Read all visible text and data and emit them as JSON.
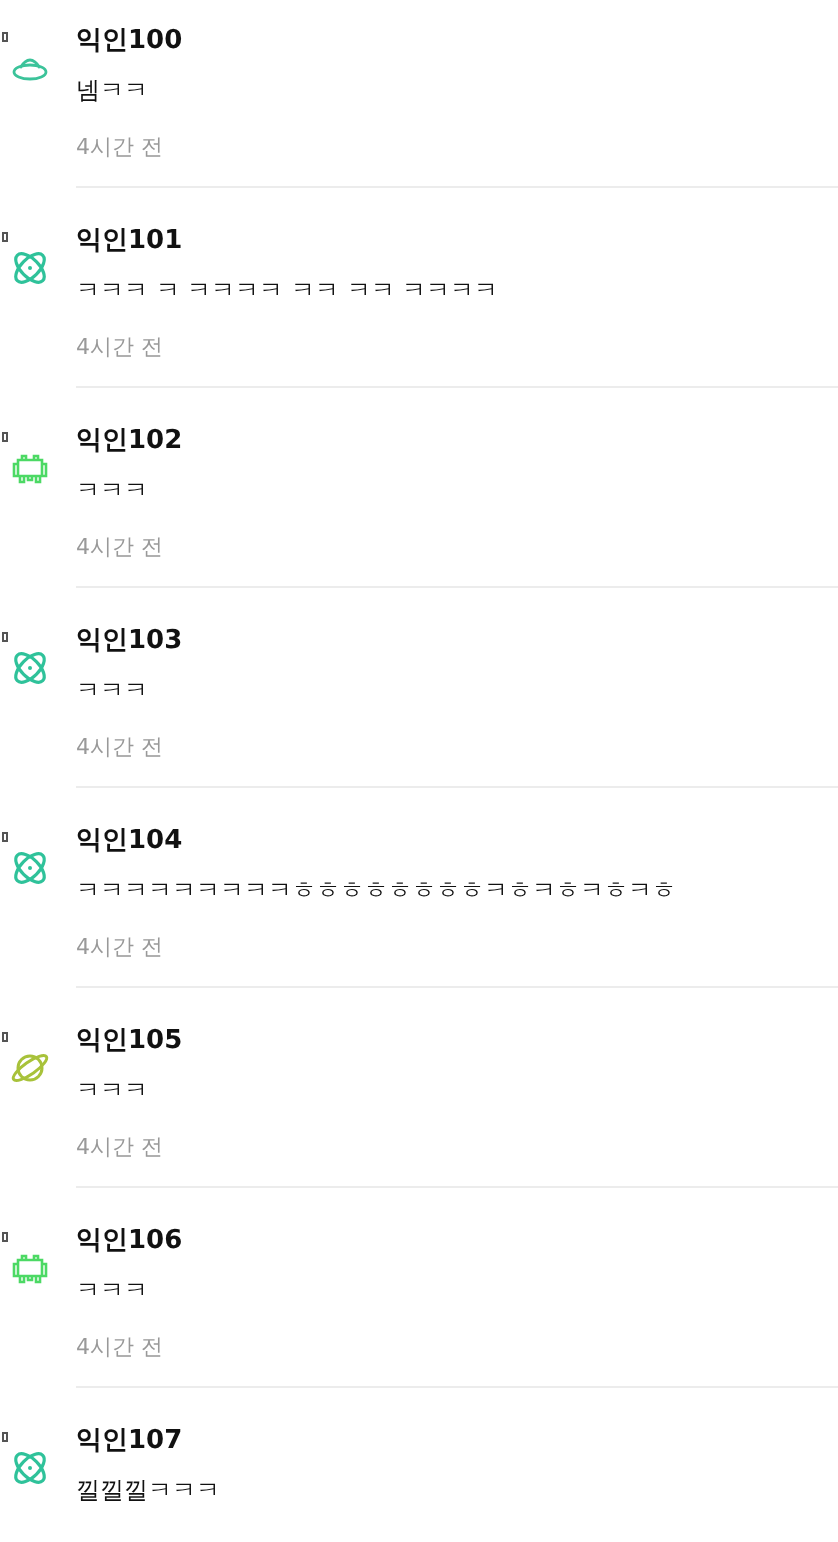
{
  "comments": [
    {
      "author": "익인100",
      "text": "넴ㅋㅋ",
      "time": "4시간 전",
      "avatar": {
        "kind": "ufo",
        "color": "#3cc39a"
      }
    },
    {
      "author": "익인101",
      "text": "ㅋㅋㅋ ㅋ ㅋㅋㅋㅋ ㅋㅋ ㅋㅋ ㅋㅋㅋㅋ",
      "time": "4시간 전",
      "avatar": {
        "kind": "atom",
        "color": "#2fc29a"
      }
    },
    {
      "author": "익인102",
      "text": "ㅋㅋㅋ",
      "time": "4시간 전",
      "avatar": {
        "kind": "invader",
        "color": "#4cd964"
      }
    },
    {
      "author": "익인103",
      "text": "ㅋㅋㅋ",
      "time": "4시간 전",
      "avatar": {
        "kind": "atom",
        "color": "#2fc29a"
      }
    },
    {
      "author": "익인104",
      "text": "ㅋㅋㅋㅋㅋㅋㅋㅋㅋㅎㅎㅎㅎㅎㅎㅎㅎㅋㅎㅋㅎㅋㅎㅋㅎ",
      "time": "4시간 전",
      "avatar": {
        "kind": "atom",
        "color": "#2fc29a"
      }
    },
    {
      "author": "익인105",
      "text": "ㅋㅋㅋ",
      "time": "4시간 전",
      "avatar": {
        "kind": "planet",
        "color": "#a8c23a"
      }
    },
    {
      "author": "익인106",
      "text": "ㅋㅋㅋ",
      "time": "4시간 전",
      "avatar": {
        "kind": "invader",
        "color": "#4cd964"
      }
    },
    {
      "author": "익인107",
      "text": "낄낄낄ㅋㅋㅋ",
      "avatar": {
        "kind": "atom",
        "color": "#2fc29a"
      }
    }
  ]
}
